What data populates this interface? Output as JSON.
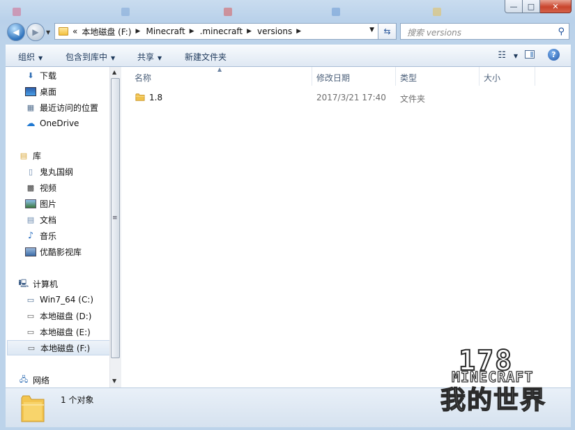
{
  "window": {
    "background_tabs": [
      {
        "label": "",
        "color": "#d36a8c"
      },
      {
        "label": "",
        "color": "#7fa7d8"
      },
      {
        "label": "",
        "color": "#d65b5b"
      },
      {
        "label": "",
        "color": "#6c9bd5"
      },
      {
        "label": "",
        "color": "#e6c15a"
      }
    ],
    "controls": {
      "minimize": "—",
      "maximize": "□",
      "close": "✕"
    }
  },
  "address": {
    "overflow": "«",
    "crumbs": [
      "本地磁盘 (F:)",
      "Minecraft",
      ".minecraft",
      "versions"
    ],
    "search_placeholder": "搜索 versions"
  },
  "toolbar": {
    "organize": "组织",
    "include_in_library": "包含到库中",
    "share": "共享",
    "new_folder": "新建文件夹"
  },
  "nav": {
    "favorites": [
      "下载",
      "桌面",
      "最近访问的位置",
      "OneDrive"
    ],
    "libraries_header": "库",
    "libraries": [
      "鬼丸国纲",
      "视频",
      "图片",
      "文档",
      "音乐",
      "优酷影视库"
    ],
    "computer_header": "计算机",
    "drives": [
      "Win7_64 (C:)",
      "本地磁盘 (D:)",
      "本地磁盘 (E:)",
      "本地磁盘 (F:)"
    ],
    "selected_drive": "本地磁盘 (F:)",
    "network_header": "网络"
  },
  "columns": {
    "name": "名称",
    "modified": "修改日期",
    "type": "类型",
    "size": "大小"
  },
  "files": [
    {
      "name": "1.8",
      "modified": "2017/3/21 17:40",
      "type": "文件夹",
      "size": ""
    }
  ],
  "status": {
    "text": "1 个对象"
  },
  "watermark": {
    "number": "178",
    "brand": "MINECRAFT",
    "cn": "我的世界"
  }
}
